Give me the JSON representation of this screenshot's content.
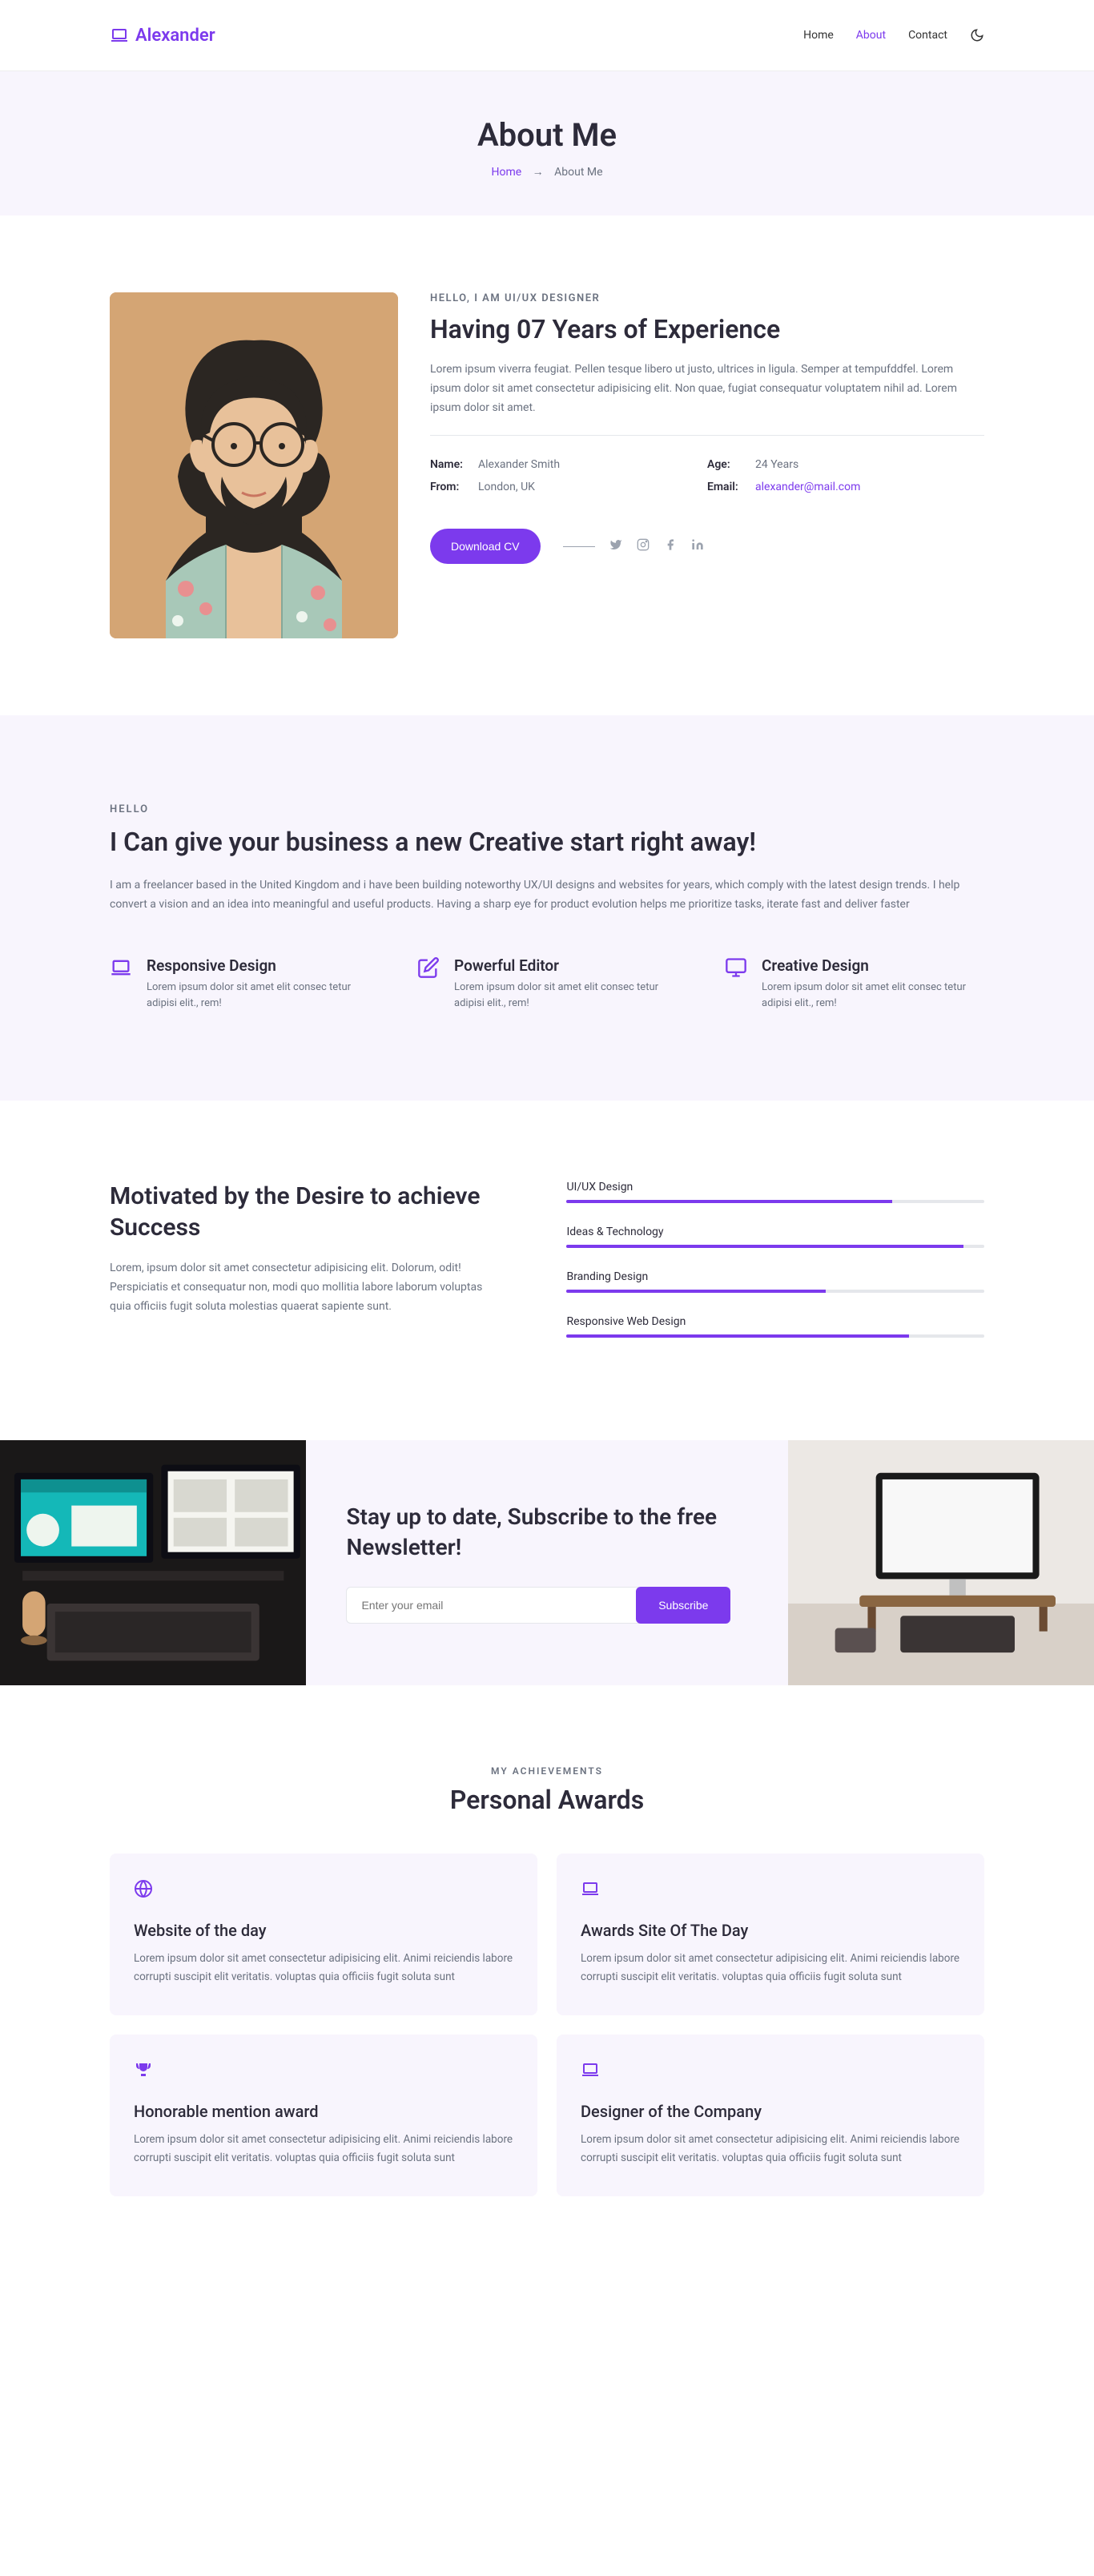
{
  "brand": "Alexander",
  "nav": {
    "home": "Home",
    "about": "About",
    "contact": "Contact"
  },
  "page_title": {
    "heading": "About Me",
    "home": "Home",
    "current": "About Me"
  },
  "about": {
    "subtitle": "HELLO, I AM UI/UX DESIGNER",
    "heading": "Having 07 Years of Experience",
    "para": "Lorem ipsum viverra feugiat. Pellen tesque libero ut justo, ultrices in ligula. Semper at tempufddfel. Lorem ipsum dolor sit amet consectetur adipisicing elit. Non quae, fugiat consequatur voluptatem nihil ad. Lorem ipsum dolor sit amet.",
    "name_label": "Name:",
    "name_val": "Alexander Smith",
    "from_label": "From:",
    "from_val": "London, UK",
    "age_label": "Age:",
    "age_val": "24 Years",
    "email_label": "Email:",
    "email_val": "alexander@mail.com",
    "cv_btn": "Download CV"
  },
  "creative": {
    "subtitle": "HELLO",
    "heading": "I Can give your business a new Creative start right away!",
    "para": "I am a freelancer based in the United Kingdom and i have been building noteworthy UX/UI designs and websites for years, which comply with the latest design trends. I help convert a vision and an idea into meaningful and useful products. Having a sharp eye for product evolution helps me prioritize tasks, iterate fast and deliver faster",
    "f1_title": "Responsive Design",
    "f1_para": "Lorem ipsum dolor sit amet elit consec tetur adipisi elit., rem!",
    "f2_title": "Powerful Editor",
    "f2_para": "Lorem ipsum dolor sit amet elit consec tetur adipisi elit., rem!",
    "f3_title": "Creative Design",
    "f3_para": "Lorem ipsum dolor sit amet elit consec tetur adipisi elit., rem!"
  },
  "skills": {
    "heading": "Motivated by the Desire to achieve Success",
    "para": "Lorem, ipsum dolor sit amet consectetur adipisicing elit. Dolorum, odit! Perspiciatis et consequatur non, modi quo mollitia labore laborum voluptas quia officiis fugit soluta molestias quaerat sapiente sunt.",
    "s1_name": "UI/UX Design",
    "s1_pct": 78,
    "s2_name": "Ideas & Technology",
    "s2_pct": 95,
    "s3_name": "Branding Design",
    "s3_pct": 62,
    "s4_name": "Responsive Web Design",
    "s4_pct": 82
  },
  "newsletter": {
    "heading": "Stay up to date, Subscribe to the free Newsletter!",
    "placeholder": "Enter your email",
    "btn": "Subscribe"
  },
  "awards": {
    "subtitle": "MY ACHIEVEMENTS",
    "heading": "Personal Awards",
    "a1_title": "Website of the day",
    "a1_para": "Lorem ipsum dolor sit amet consectetur adipisicing elit. Animi reiciendis labore corrupti suscipit elit veritatis. voluptas quia officiis fugit soluta sunt",
    "a2_title": "Awards Site Of The Day",
    "a2_para": "Lorem ipsum dolor sit amet consectetur adipisicing elit. Animi reiciendis labore corrupti suscipit elit veritatis. voluptas quia officiis fugit soluta sunt",
    "a3_title": "Honorable mention award",
    "a3_para": "Lorem ipsum dolor sit amet consectetur adipisicing elit. Animi reiciendis labore corrupti suscipit elit veritatis. voluptas quia officiis fugit soluta sunt",
    "a4_title": "Designer of the Company",
    "a4_para": "Lorem ipsum dolor sit amet consectetur adipisicing elit. Animi reiciendis labore corrupti suscipit elit veritatis. voluptas quia officiis fugit soluta sunt"
  }
}
